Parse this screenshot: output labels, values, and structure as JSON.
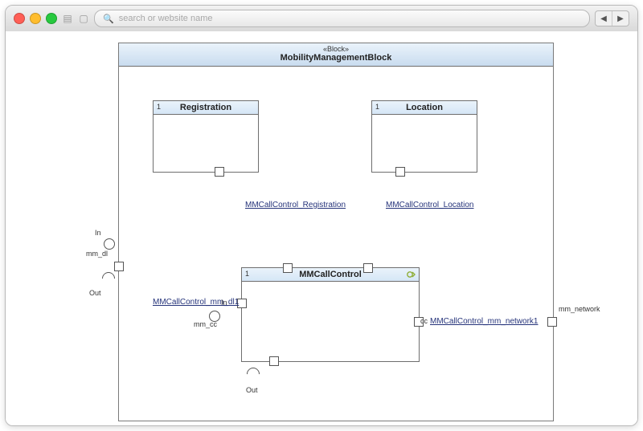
{
  "browser": {
    "search_placeholder": "search or website name"
  },
  "diagram": {
    "stereotype": "«Block»",
    "title": "MobilityManagementBlock",
    "blocks": {
      "registration": {
        "label": "Registration",
        "multiplicity": "1"
      },
      "location": {
        "label": "Location",
        "multiplicity": "1"
      },
      "mmcallcontrol": {
        "label": "MMCallControl",
        "multiplicity": "1"
      }
    },
    "connectors": {
      "reg": "MMCallControl_Registration",
      "loc": "MMCallControl_Location",
      "mm_dl1": "MMCallControl_mm_dl1",
      "mm_net1": "MMCallControl_mm_network1"
    },
    "ports": {
      "mm_dl": "mm_dl",
      "mm_network": "mm_network",
      "mm_cc": "mm_cc",
      "cc": "cc",
      "in": "In",
      "out": "Out"
    }
  }
}
